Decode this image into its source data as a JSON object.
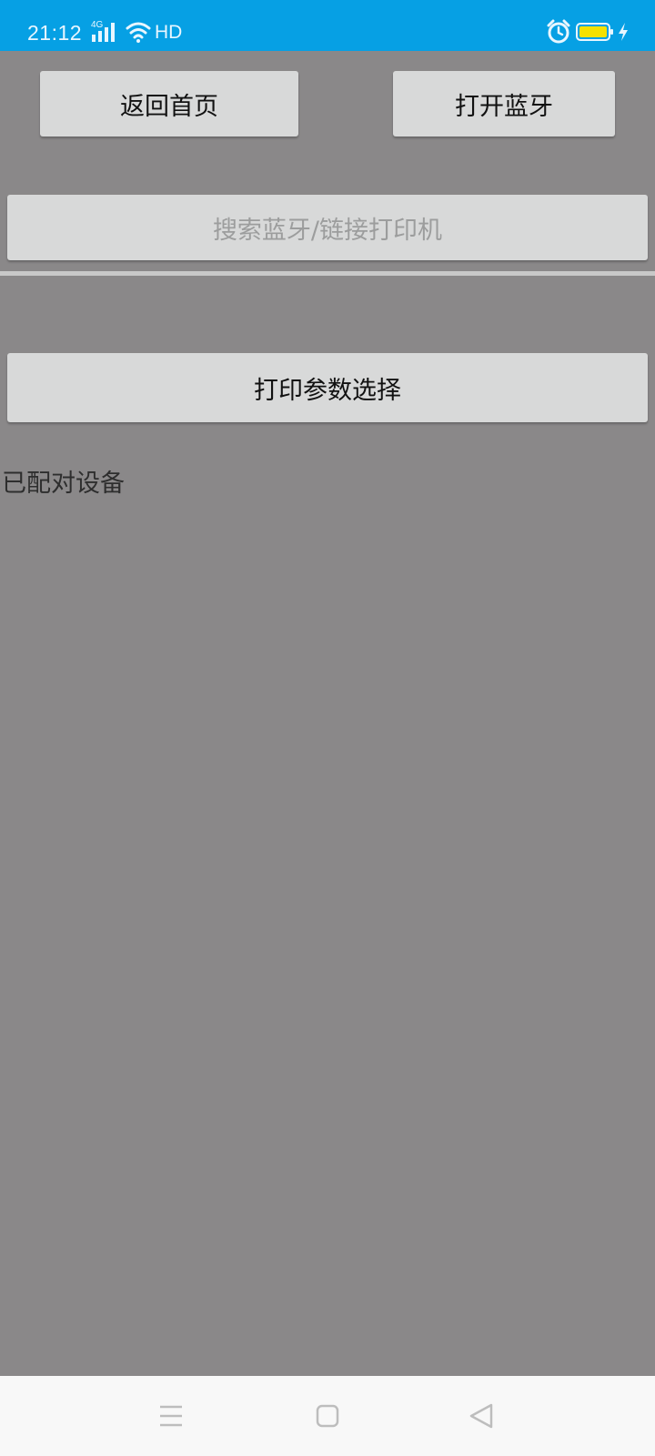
{
  "status_bar": {
    "time": "21:12",
    "network_type": "4G",
    "hd_label": "HD",
    "icons": [
      "signal-icon",
      "wifi-icon",
      "alarm-icon",
      "battery-icon",
      "charging-icon"
    ],
    "background_color": "#06a0e4",
    "battery_color": "#f5e100"
  },
  "toolbar": {
    "back_home_label": "返回首页",
    "open_bluetooth_label": "打开蓝牙"
  },
  "search": {
    "label": "搜索蓝牙/链接打印机"
  },
  "params": {
    "label": "打印参数选择"
  },
  "paired": {
    "label": "已配对设备"
  },
  "nav": {
    "icons": [
      "menu-icon",
      "home-square-icon",
      "back-triangle-icon"
    ]
  }
}
